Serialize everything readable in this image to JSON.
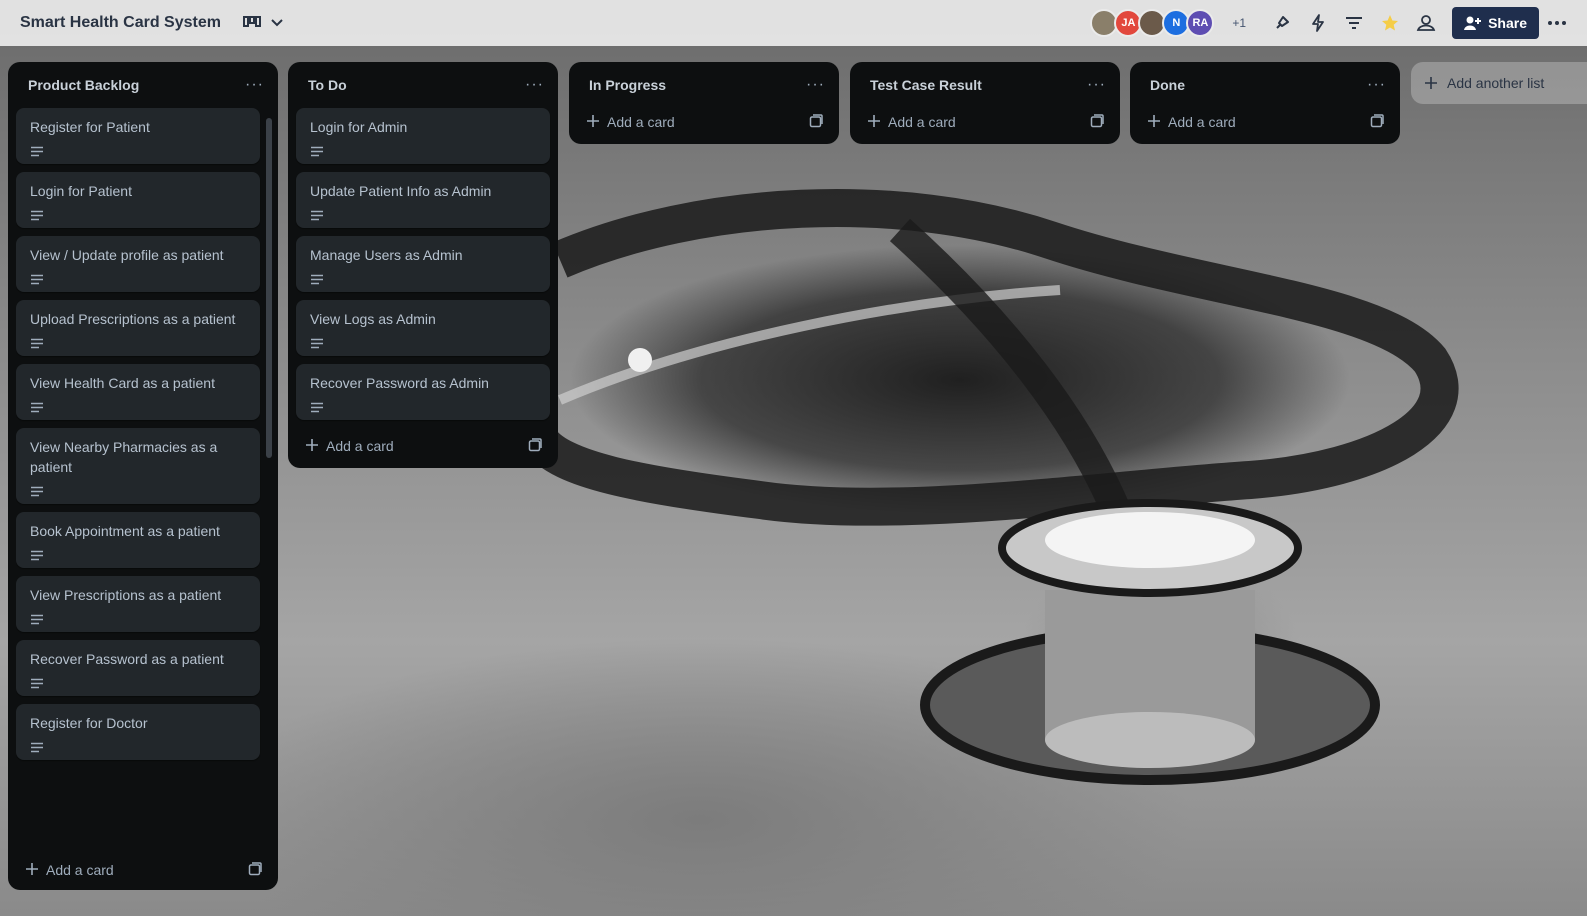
{
  "header": {
    "board_title": "Smart Health Card System",
    "avatars": [
      {
        "initials": "",
        "color": "#8a7f6a"
      },
      {
        "initials": "JA",
        "color": "#e2483d"
      },
      {
        "initials": "",
        "color": "#6b5a4a"
      },
      {
        "initials": "N",
        "color": "#1d6ee0"
      },
      {
        "initials": "RA",
        "color": "#5e4db2"
      }
    ],
    "extra_members": "+1",
    "share_label": "Share"
  },
  "lists": [
    {
      "title": "Product Backlog",
      "cards": [
        "Register for Patient",
        "Login for Patient",
        "View / Update profile as patient",
        "Upload Prescriptions as a patient",
        "View Health Card as a patient",
        "View Nearby Pharmacies as a patient",
        "Book Appointment as a patient",
        "View Prescriptions as a patient",
        "Recover Password as a patient",
        "Register for Doctor"
      ],
      "add_card": "Add a card"
    },
    {
      "title": "To Do",
      "cards": [
        "Login for Admin",
        "Update Patient Info as Admin",
        "Manage Users as Admin",
        "View Logs as Admin",
        "Recover Password as Admin"
      ],
      "add_card": "Add a card"
    },
    {
      "title": "In Progress",
      "cards": [],
      "add_card": "Add a card"
    },
    {
      "title": "Test Case Result",
      "cards": [],
      "add_card": "Add a card"
    },
    {
      "title": "Done",
      "cards": [],
      "add_card": "Add a card"
    }
  ],
  "add_list_label": "Add another list",
  "colors": {
    "accent": "#1f2e4d",
    "list_bg": "#0d0f10",
    "card_bg": "#22272b",
    "star": "#f5cd47"
  }
}
